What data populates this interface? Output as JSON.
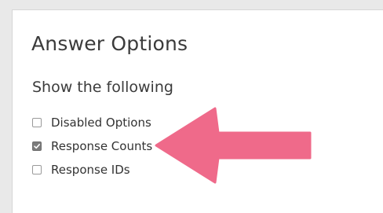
{
  "panel": {
    "title": "Answer Options",
    "subtitle": "Show the following"
  },
  "options": [
    {
      "label": "Disabled Options",
      "checked": false
    },
    {
      "label": "Response Counts",
      "checked": true
    },
    {
      "label": "Response IDs",
      "checked": false
    }
  ],
  "annotation": {
    "icon": "arrow-left-icon",
    "color": "#ef6a8a"
  }
}
